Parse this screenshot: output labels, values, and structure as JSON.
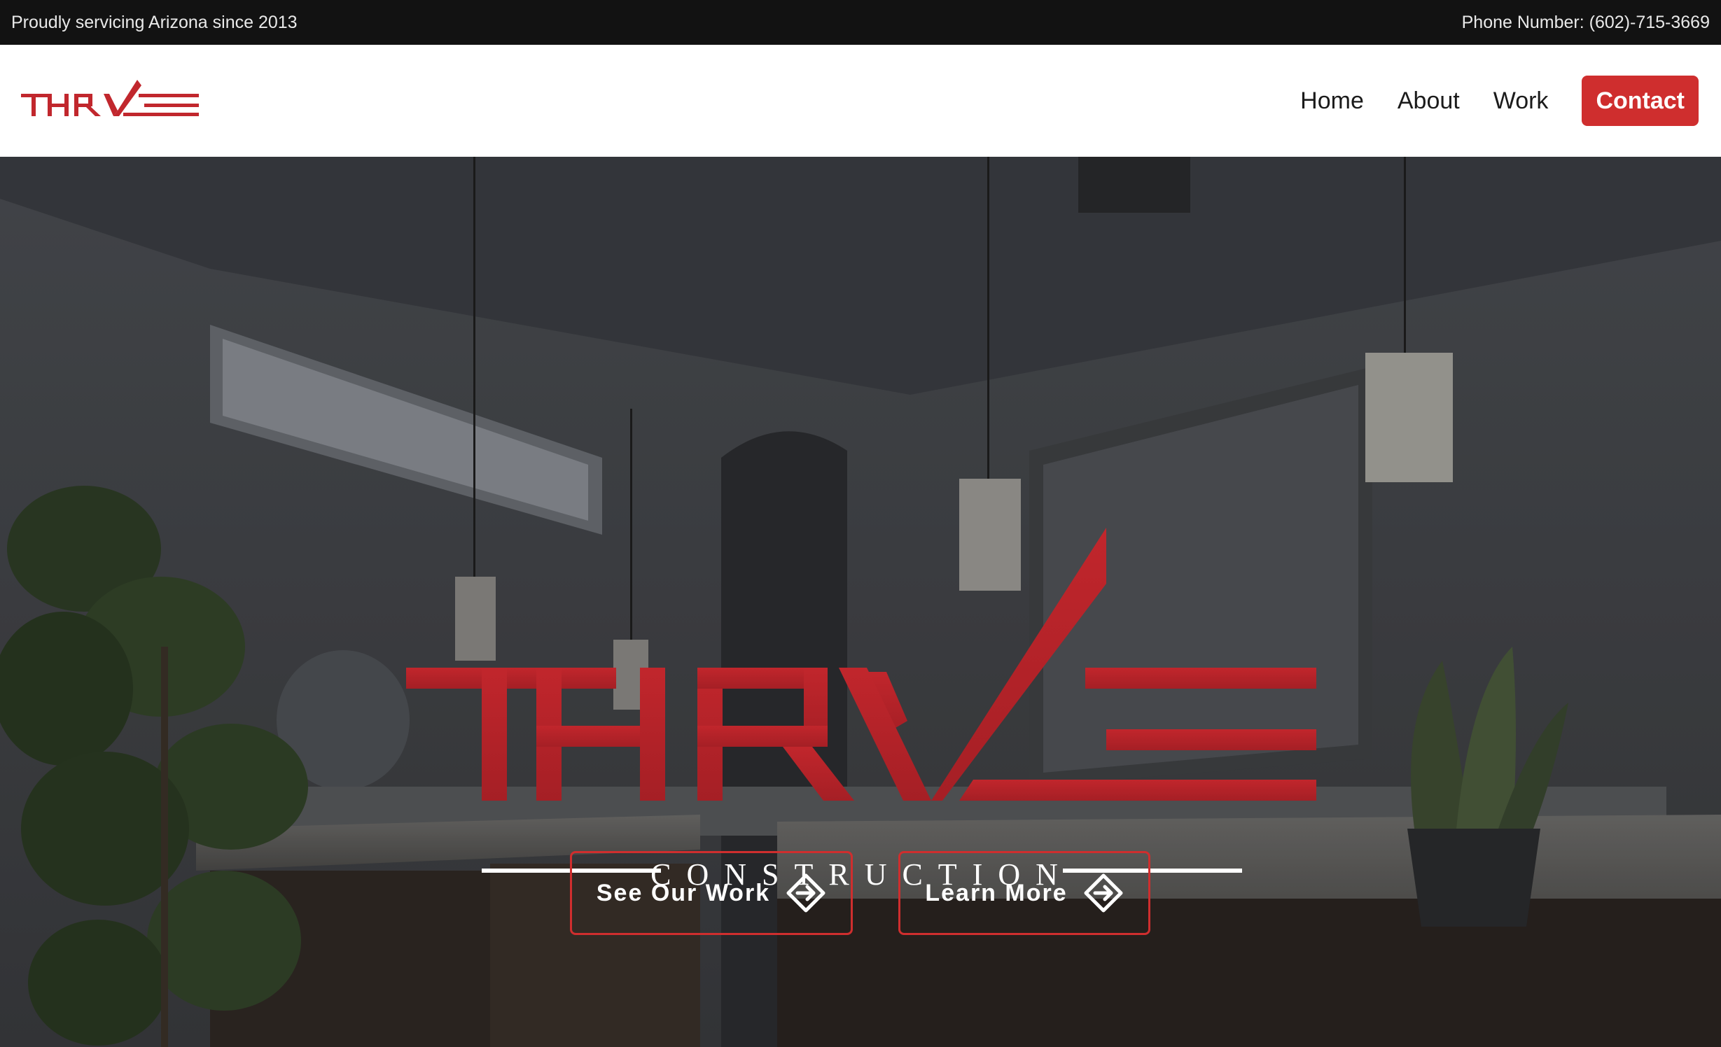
{
  "topbar": {
    "tagline": "Proudly servicing Arizona since 2013",
    "phone": "Phone Number: (602)-715-3669"
  },
  "brand": {
    "name": "THRIVE",
    "subtitle": "CONSTRUCTION",
    "accent_color": "#cf2e2e"
  },
  "nav": {
    "home": "Home",
    "about": "About",
    "work": "Work",
    "contact": "Contact"
  },
  "hero": {
    "background": "darkened-photo-of-modern-bathroom",
    "cta_primary": "See Our Work",
    "cta_secondary": "Learn More",
    "cta_icon": "diamond-arrow-right-icon"
  }
}
